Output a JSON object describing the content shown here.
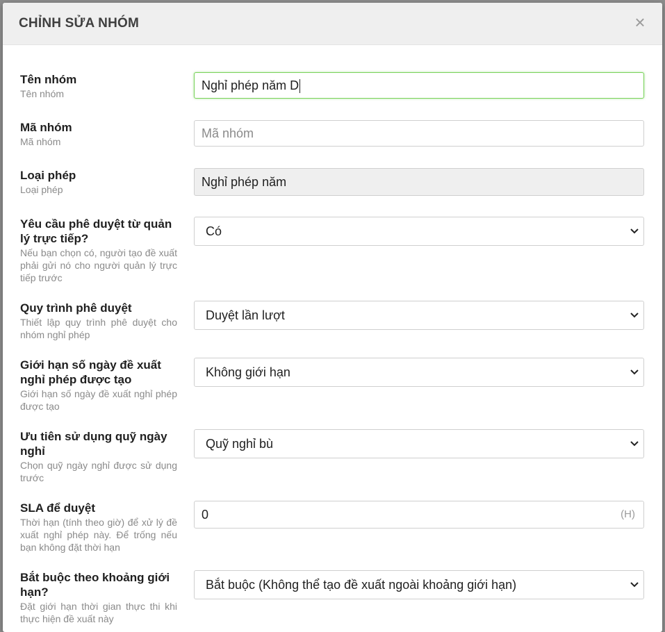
{
  "modal": {
    "title": "CHỈNH SỬA NHÓM",
    "close_symbol": "×"
  },
  "fields": {
    "group_name": {
      "label": "Tên nhóm",
      "hint": "Tên nhóm",
      "value": "Nghỉ phép năm D"
    },
    "group_code": {
      "label": "Mã nhóm",
      "hint": "Mã nhóm",
      "placeholder": "Mã nhóm"
    },
    "leave_type": {
      "label": "Loại phép",
      "hint": "Loại phép",
      "value": "Nghỉ phép năm"
    },
    "manager_approval": {
      "label": "Yêu cầu phê duyệt từ quản lý trực tiếp?",
      "hint": "Nếu bạn chọn có, người tạo đề xuất phải gửi nó cho người quản lý trực tiếp trước",
      "value": "Có"
    },
    "approval_flow": {
      "label": "Quy trình phê duyệt",
      "hint": "Thiết lập quy trình phê duyệt cho nhóm nghỉ phép",
      "value": "Duyệt lần lượt"
    },
    "day_limit": {
      "label": "Giới hạn số ngày đề xuất nghỉ phép được tạo",
      "hint": "Giới hạn số ngày đề xuất nghỉ phép được tạo",
      "value": "Không giới hạn"
    },
    "fund_priority": {
      "label": "Ưu tiên sử dụng quỹ ngày nghỉ",
      "hint": "Chọn quỹ ngày nghỉ được sử dụng trước",
      "value": "Quỹ nghỉ bù"
    },
    "sla": {
      "label": "SLA để duyệt",
      "hint": "Thời hạn (tính theo giờ) để xử lý đề xuất nghỉ phép này. Để trống nếu bạn không đặt thời hạn",
      "value": "0",
      "unit": "(H)"
    },
    "limit_required": {
      "label": "Bắt buộc theo khoảng giới hạn?",
      "hint": "Đặt giới hạn thời gian thực thi khi thực hiện đề xuất này",
      "value": "Bắt buộc (Không thể tạo đề xuất ngoài khoảng giới hạn)"
    }
  },
  "icons": {
    "close": "close-icon",
    "dropdown": "chevron-down-icon"
  },
  "colors": {
    "focus_border": "#7ad35a",
    "header_bg": "#efefef",
    "readonly_bg": "#efefef"
  }
}
